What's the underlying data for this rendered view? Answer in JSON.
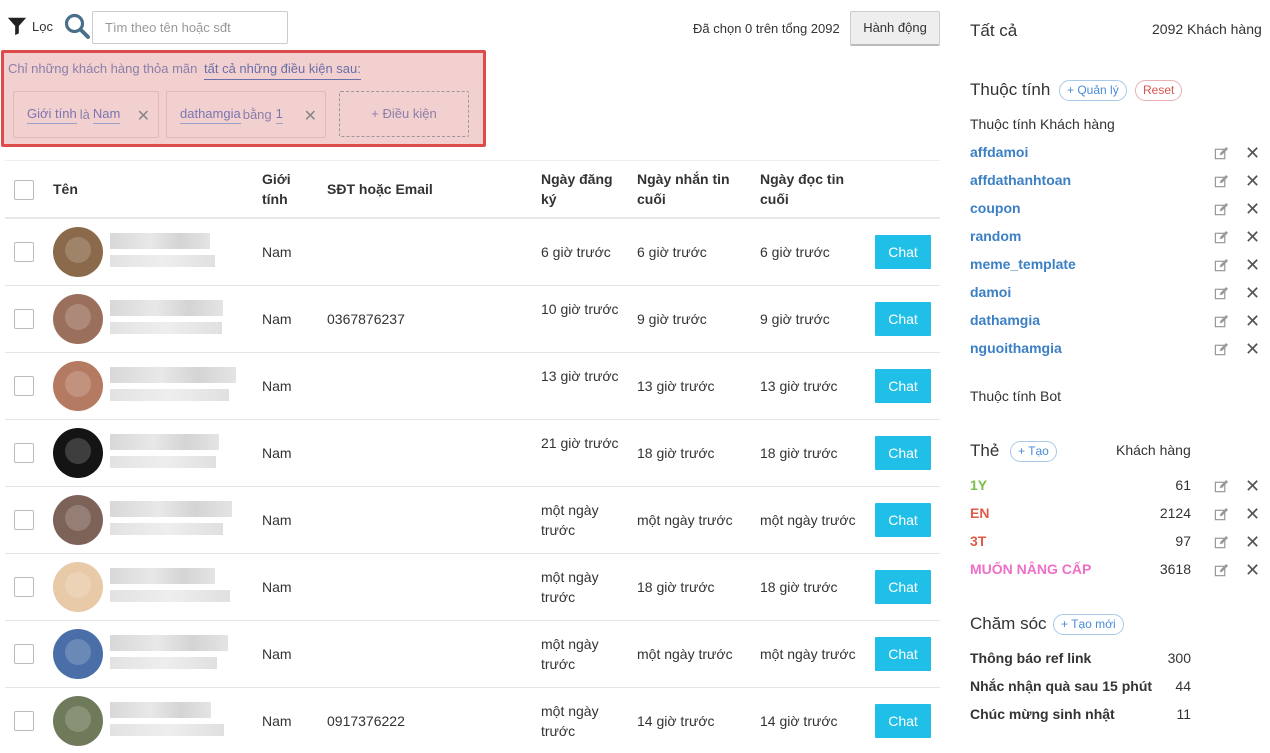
{
  "topbar": {
    "filter_label": "Lọc",
    "search_placeholder": "Tìm theo tên hoặc sđt",
    "selection_text": "Đã chọn 0 trên tổng 2092",
    "action_label": "Hành động"
  },
  "conditions": {
    "title_prefix": "Chỉ những khách hàng thỏa mãn",
    "title_link": "tất cả những điều kiện sau:",
    "chips": [
      {
        "field": "Giới tính",
        "op": "là",
        "value": "Nam"
      },
      {
        "field": "dathamgia",
        "op": "bằng",
        "value": "1"
      }
    ],
    "add_label": "+ Điều kiện",
    "remove_glyph": "✕"
  },
  "table": {
    "headers": {
      "name": "Tên",
      "gender": "Giới tính",
      "contact": "SĐT hoặc Email",
      "registered": "Ngày đăng ký",
      "last_msg": "Ngày nhắn tin cuối",
      "last_read": "Ngày đọc tin cuối"
    },
    "chat_label": "Chat",
    "rows": [
      {
        "gender": "Nam",
        "contact": "",
        "registered": "6 giờ trước",
        "last_msg": "6 giờ trước",
        "last_read": "6 giờ trước",
        "avatar_color": "#8a6a4a"
      },
      {
        "gender": "Nam",
        "contact": "0367876237",
        "registered": "10 giờ trước",
        "last_msg": "9 giờ trước",
        "last_read": "9 giờ trước",
        "avatar_color": "#9a6f5c"
      },
      {
        "gender": "Nam",
        "contact": "",
        "registered": "13 giờ trước",
        "last_msg": "13 giờ trước",
        "last_read": "13 giờ trước",
        "avatar_color": "#b57a62"
      },
      {
        "gender": "Nam",
        "contact": "",
        "registered": "21 giờ trước",
        "last_msg": "18 giờ trước",
        "last_read": "18 giờ trước",
        "avatar_color": "#141414"
      },
      {
        "gender": "Nam",
        "contact": "",
        "registered": "một ngày trước",
        "last_msg": "một ngày trước",
        "last_read": "một ngày trước",
        "avatar_color": "#7d6258"
      },
      {
        "gender": "Nam",
        "contact": "",
        "registered": "một ngày trước",
        "last_msg": "18 giờ trước",
        "last_read": "18 giờ trước",
        "avatar_color": "#e8c9a8"
      },
      {
        "gender": "Nam",
        "contact": "",
        "registered": "một ngày trước",
        "last_msg": "một ngày trước",
        "last_read": "một ngày trước",
        "avatar_color": "#4a6fa8"
      },
      {
        "gender": "Nam",
        "contact": "0917376222",
        "registered": "một ngày trước",
        "last_msg": "14 giờ trước",
        "last_read": "14 giờ trước",
        "avatar_color": "#6e7a5a"
      }
    ]
  },
  "sidebar": {
    "all_label": "Tất cả",
    "total_customers": "2092 Khách hàng",
    "attributes": {
      "title": "Thuộc tính",
      "manage_label": "+ Quản lý",
      "reset_label": "Reset",
      "customer_attr_title": "Thuộc tính Khách hàng",
      "items": [
        "affdamoi",
        "affdathanhtoan",
        "coupon",
        "random",
        "meme_template",
        "damoi",
        "dathamgia",
        "nguoithamgia"
      ],
      "bot_attr_title": "Thuộc tính Bot"
    },
    "tags": {
      "title": "Thẻ",
      "create_label": "+ Tạo",
      "count_header": "Khách hàng",
      "items": [
        {
          "name": "1Y",
          "count": "61",
          "color": "#7cc04a"
        },
        {
          "name": "EN",
          "count": "2124",
          "color": "#e05a4a"
        },
        {
          "name": "3T",
          "count": "97",
          "color": "#e05a4a"
        },
        {
          "name": "MUỐN NÂNG CẤP",
          "count": "3618",
          "color": "#ee6fc8"
        }
      ]
    },
    "care": {
      "title": "Chăm sóc",
      "create_label": "+ Tạo mới",
      "items": [
        {
          "name": "Thông báo ref link",
          "count": "300"
        },
        {
          "name": "Nhắc nhận quà sau 15 phút",
          "count": "44"
        },
        {
          "name": "Chúc mừng sinh nhật",
          "count": "11"
        }
      ]
    }
  }
}
